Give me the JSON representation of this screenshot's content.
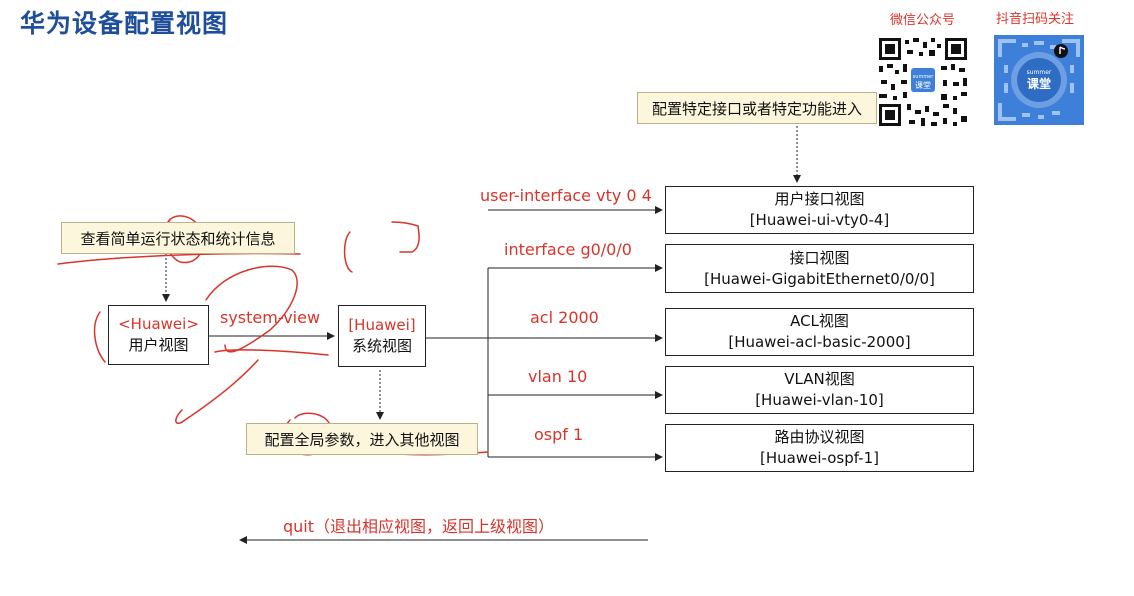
{
  "header": {
    "title": "华为设备配置视图"
  },
  "qr_codes": {
    "wechat_label": "微信公众号",
    "douyin_label": "抖音扫码关注",
    "center_brand": "summer",
    "center_text": "课堂"
  },
  "notes": {
    "top_right": "配置特定接口或者特定功能进入",
    "left": "查看简单运行状态和统计信息",
    "bottom": "配置全局参数，进入其他视图"
  },
  "user_view": {
    "prompt": "<Huawei>",
    "name": "用户视图"
  },
  "system_view": {
    "prompt": "[Huawei]",
    "name": "系统视图"
  },
  "commands": {
    "system_view": "system-view",
    "ui_vty": "user-interface vty 0 4",
    "interface": "interface g0/0/0",
    "acl": "acl 2000",
    "vlan": "vlan 10",
    "ospf": "ospf 1",
    "quit": "quit（退出相应视图，返回上级视图）"
  },
  "views": [
    {
      "name": "用户接口视图",
      "prompt": "[Huawei-ui-vty0-4]"
    },
    {
      "name": "接口视图",
      "prompt": "[Huawei-GigabitEthernet0/0/0]"
    },
    {
      "name": "ACL视图",
      "prompt": "[Huawei-acl-basic-2000]"
    },
    {
      "name": "VLAN视图",
      "prompt": "[Huawei-vlan-10]"
    },
    {
      "name": "路由协议视图",
      "prompt": "[Huawei-ospf-1]"
    }
  ],
  "colors": {
    "title": "#1f4e9a",
    "command": "#d9342b",
    "note_bg": "#fcf6dc",
    "annotation": "#d9342b",
    "douyin_bg": "#3d7fd9"
  }
}
